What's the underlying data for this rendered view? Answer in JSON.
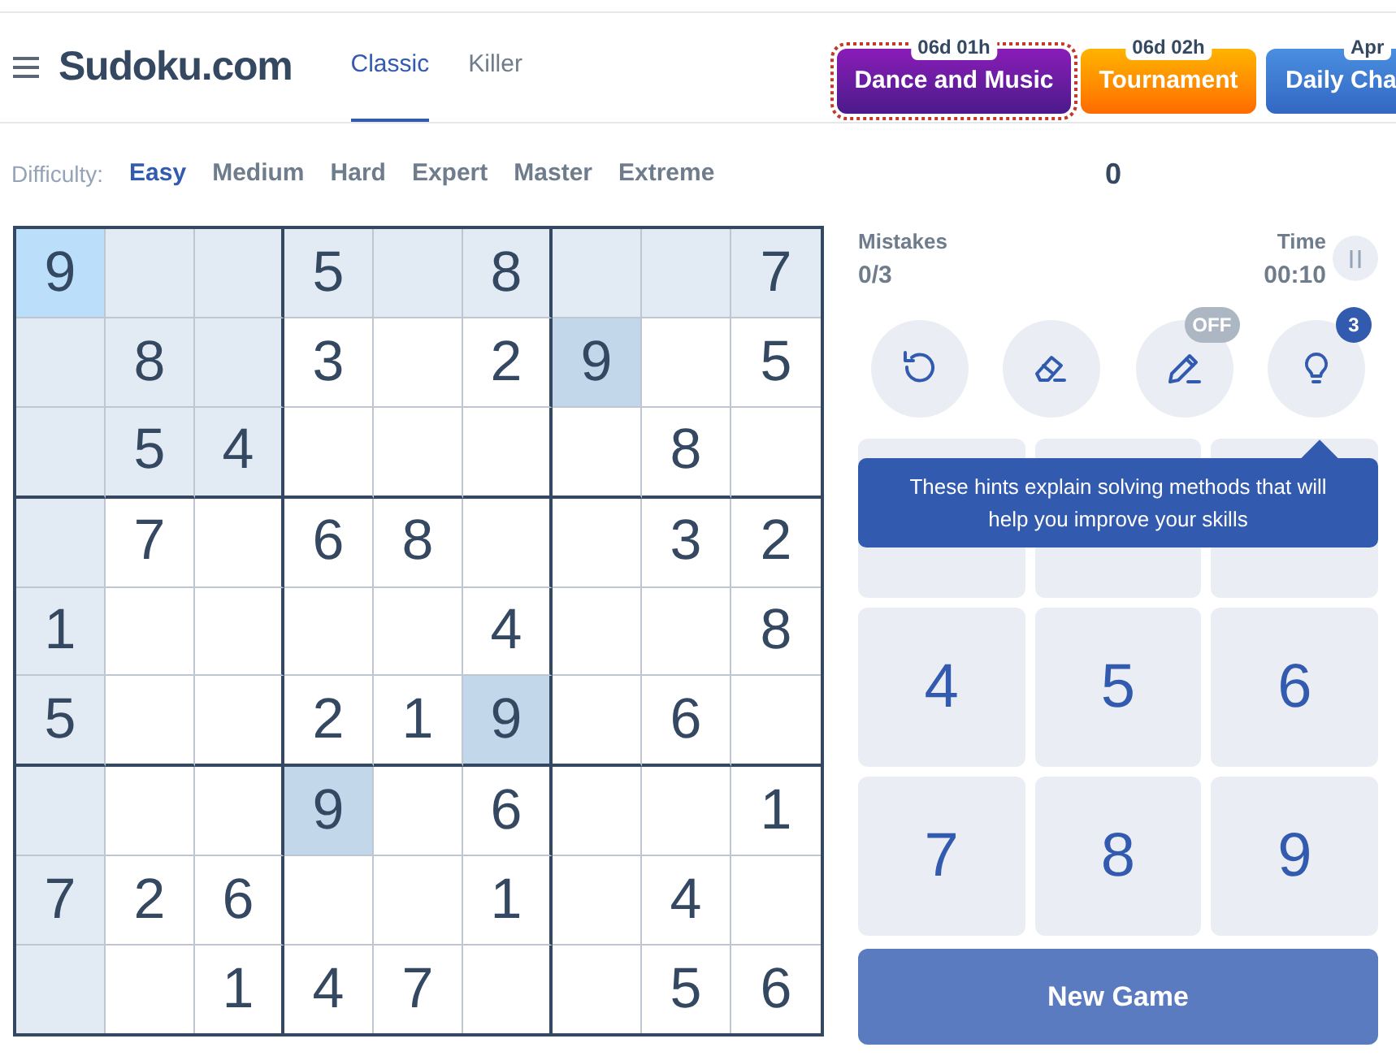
{
  "header": {
    "logo": "Sudoku.com",
    "modes": [
      {
        "label": "Classic",
        "selected": true
      },
      {
        "label": "Killer",
        "selected": false
      }
    ],
    "events": [
      {
        "label": "Dance and Music",
        "badge": "06d 01h",
        "kind": "purple",
        "focused": true
      },
      {
        "label": "Tournament",
        "badge": "06d 02h",
        "kind": "orange",
        "focused": false
      },
      {
        "label": "Daily Cha",
        "badge": "Apr",
        "kind": "blue",
        "focused": false
      }
    ]
  },
  "difficulty": {
    "label": "Difficulty:",
    "options": [
      {
        "label": "Easy",
        "selected": true
      },
      {
        "label": "Medium",
        "selected": false
      },
      {
        "label": "Hard",
        "selected": false
      },
      {
        "label": "Expert",
        "selected": false
      },
      {
        "label": "Master",
        "selected": false
      },
      {
        "label": "Extreme",
        "selected": false
      }
    ]
  },
  "score": "0",
  "board": [
    [
      {
        "value": "9",
        "selected": true
      },
      {
        "selected": false
      },
      {
        "selected": false
      },
      {
        "value": "5",
        "selected": false
      },
      {
        "selected": false
      },
      {
        "value": "8",
        "selected": false
      },
      {
        "selected": false
      },
      {
        "selected": false
      },
      {
        "value": "7",
        "selected": false
      }
    ],
    [
      {
        "selected": false
      },
      {
        "value": "8",
        "selected": false
      },
      {
        "selected": false
      },
      {
        "value": "3",
        "selected": false
      },
      {
        "selected": false
      },
      {
        "value": "2",
        "selected": false
      },
      {
        "value": "9",
        "selected": false
      },
      {
        "selected": false
      },
      {
        "value": "5",
        "selected": false
      }
    ],
    [
      {
        "selected": false
      },
      {
        "value": "5",
        "selected": false
      },
      {
        "value": "4",
        "selected": false
      },
      {
        "selected": false
      },
      {
        "selected": false
      },
      {
        "selected": false
      },
      {
        "selected": false
      },
      {
        "value": "8",
        "selected": false
      },
      {
        "selected": false
      }
    ],
    [
      {
        "selected": false
      },
      {
        "value": "7",
        "selected": false
      },
      {
        "selected": false
      },
      {
        "value": "6",
        "selected": false
      },
      {
        "value": "8",
        "selected": false
      },
      {
        "selected": false
      },
      {
        "selected": false
      },
      {
        "value": "3",
        "selected": false
      },
      {
        "value": "2",
        "selected": false
      }
    ],
    [
      {
        "value": "1",
        "selected": false
      },
      {
        "selected": false
      },
      {
        "selected": false
      },
      {
        "selected": false
      },
      {
        "selected": false
      },
      {
        "value": "4",
        "selected": false
      },
      {
        "selected": false
      },
      {
        "selected": false
      },
      {
        "value": "8",
        "selected": false
      }
    ],
    [
      {
        "value": "5",
        "selected": false
      },
      {
        "selected": false
      },
      {
        "selected": false
      },
      {
        "value": "2",
        "selected": false
      },
      {
        "value": "1",
        "selected": false
      },
      {
        "value": "9",
        "selected": false
      },
      {
        "selected": false
      },
      {
        "value": "6",
        "selected": false
      },
      {
        "selected": false
      }
    ],
    [
      {
        "selected": false
      },
      {
        "selected": false
      },
      {
        "selected": false
      },
      {
        "value": "9",
        "selected": false
      },
      {
        "selected": false
      },
      {
        "value": "6",
        "selected": false
      },
      {
        "selected": false
      },
      {
        "selected": false
      },
      {
        "value": "1",
        "selected": false
      }
    ],
    [
      {
        "value": "7",
        "selected": false
      },
      {
        "value": "2",
        "selected": false
      },
      {
        "value": "6",
        "selected": false
      },
      {
        "selected": false
      },
      {
        "selected": false
      },
      {
        "value": "1",
        "selected": false
      },
      {
        "selected": false
      },
      {
        "value": "4",
        "selected": false
      },
      {
        "selected": false
      }
    ],
    [
      {
        "selected": false
      },
      {
        "selected": false
      },
      {
        "value": "1",
        "selected": false
      },
      {
        "value": "4",
        "selected": false
      },
      {
        "value": "7",
        "selected": false
      },
      {
        "selected": false
      },
      {
        "selected": false
      },
      {
        "value": "5",
        "selected": false
      },
      {
        "value": "6",
        "selected": false
      }
    ]
  ],
  "stats": {
    "mistakes_label": "Mistakes",
    "mistakes": "0/3",
    "time_label": "Time",
    "time": "00:10"
  },
  "tools": [
    {
      "kind": "undo"
    },
    {
      "kind": "erase"
    },
    {
      "kind": "notes",
      "badge": "OFF"
    },
    {
      "kind": "hint",
      "badge": "3"
    }
  ],
  "tooltip": "These hints explain solving methods that will help you improve your skills",
  "keypad": [
    "4",
    "5",
    "6",
    "7",
    "8",
    "9"
  ],
  "new_game": "New Game"
}
